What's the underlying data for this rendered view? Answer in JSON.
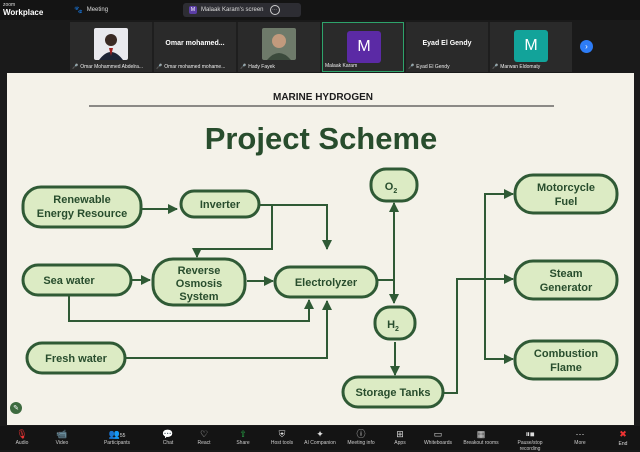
{
  "app": {
    "brand_small": "zoom",
    "brand": "Workplace"
  },
  "tabs": [
    {
      "label": "Meeting"
    },
    {
      "label": "Malaak Karam's screen",
      "badge": "M"
    }
  ],
  "participants": [
    {
      "name": "Omar Mohammed Abdelra..."
    },
    {
      "name": "Omar mohamed mohame...",
      "center": "Omar  mohamed..."
    },
    {
      "name": "Hady Fayek"
    },
    {
      "name": "Malaak Karam",
      "avatar": "M",
      "color": "#5b2aa5"
    },
    {
      "name": "Eyad El Gendy",
      "center": "Eyad El Gendy"
    },
    {
      "name": "Marwan Eldomaty",
      "avatar": "M",
      "color": "#12a39a"
    }
  ],
  "slide": {
    "header": "MARINE HYDROGEN",
    "title": "Project Scheme",
    "nodes": {
      "renewable_1": "Renewable",
      "renewable_2": "Energy Resource",
      "inverter": "Inverter",
      "o2": "O",
      "o2_sub": "2",
      "motorcycle_1": "Motorcycle",
      "motorcycle_2": "Fuel",
      "seawater": "Sea water",
      "ro_1": "Reverse",
      "ro_2": "Osmosis",
      "ro_3": "System",
      "electrolyzer": "Electrolyzer",
      "steam_1": "Steam",
      "steam_2": "Generator",
      "h2": "H",
      "h2_sub": "2",
      "freshwater": "Fresh water",
      "storage": "Storage Tanks",
      "combustion_1": "Combustion",
      "combustion_2": "Flame"
    },
    "colors": {
      "fill": "#dcebc4",
      "stroke": "#2f5a35",
      "text": "#284d2d",
      "bg": "#f4f2e9"
    }
  },
  "toolbar": {
    "audio": "Audio",
    "video": "Video",
    "participants": "Participants",
    "participants_count": "55",
    "chat": "Chat",
    "react": "React",
    "share": "Share",
    "host_tools": "Host tools",
    "ai": "AI Companion",
    "meeting_info": "Meeting info",
    "apps": "Apps",
    "whiteboards": "Whiteboards",
    "breakout": "Breakout rooms",
    "pause": "Pause/stop recording",
    "more": "More",
    "end": "End"
  }
}
